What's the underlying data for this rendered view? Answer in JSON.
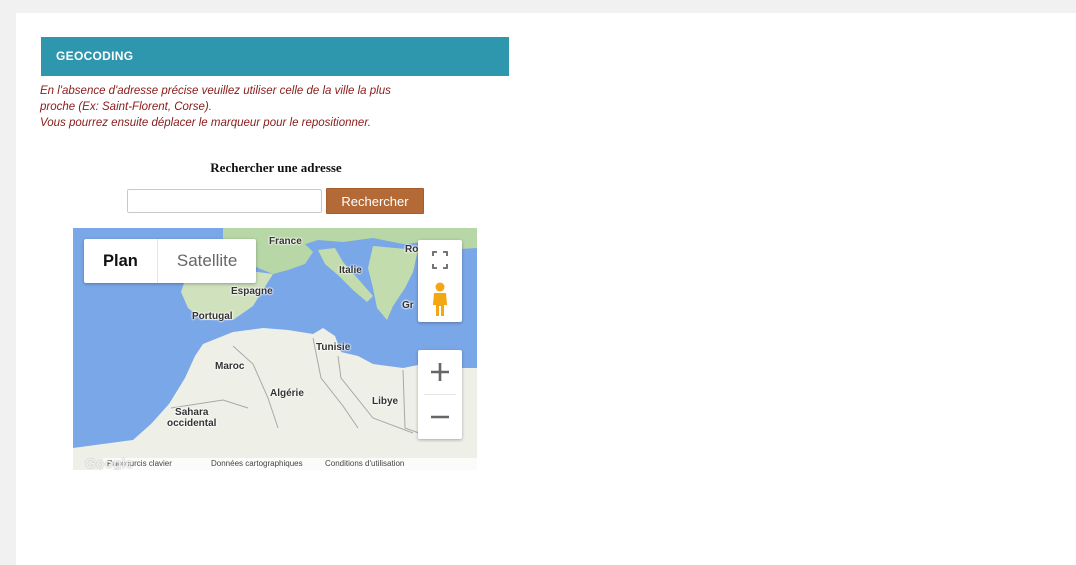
{
  "panel": {
    "title": "GEOCODING",
    "notice_line1": "En l'absence d'adresse précise veuillez utiliser celle de la ville la plus",
    "notice_line2": "proche (Ex: Saint-Florent, Corse).",
    "notice_line3": "Vous pourrez ensuite déplacer le marqueur pour le repositionner."
  },
  "search": {
    "title": "Rechercher une adresse",
    "input_value": "",
    "placeholder": "",
    "button_label": "Rechercher"
  },
  "map": {
    "type_plan": "Plan",
    "type_satellite": "Satellite",
    "labels": {
      "france": "France",
      "italie": "Italie",
      "espagne": "Espagne",
      "portugal": "Portugal",
      "tunisie": "Tunisie",
      "maroc": "Maroc",
      "algerie": "Algérie",
      "libye": "Libye",
      "sahara_1": "Sahara",
      "sahara_2": "occidental",
      "ro": "Ro",
      "gr": "Gr"
    },
    "zoom_in": "+",
    "zoom_out": "−",
    "google_logo": "Google",
    "footer": {
      "shortcuts": "Raccourcis clavier",
      "data": "Données cartographiques",
      "terms": "Conditions d'utilisation"
    }
  },
  "colors": {
    "header_bg": "#2e97ad",
    "notice_text": "#8b1a1a",
    "button_bg": "#b36a36",
    "sea": "#7aa7e8",
    "land": "#dfeadb",
    "green_land": "#b7d7a6"
  },
  "icons": {
    "fullscreen": "fullscreen-icon",
    "pegman": "pegman-icon"
  }
}
